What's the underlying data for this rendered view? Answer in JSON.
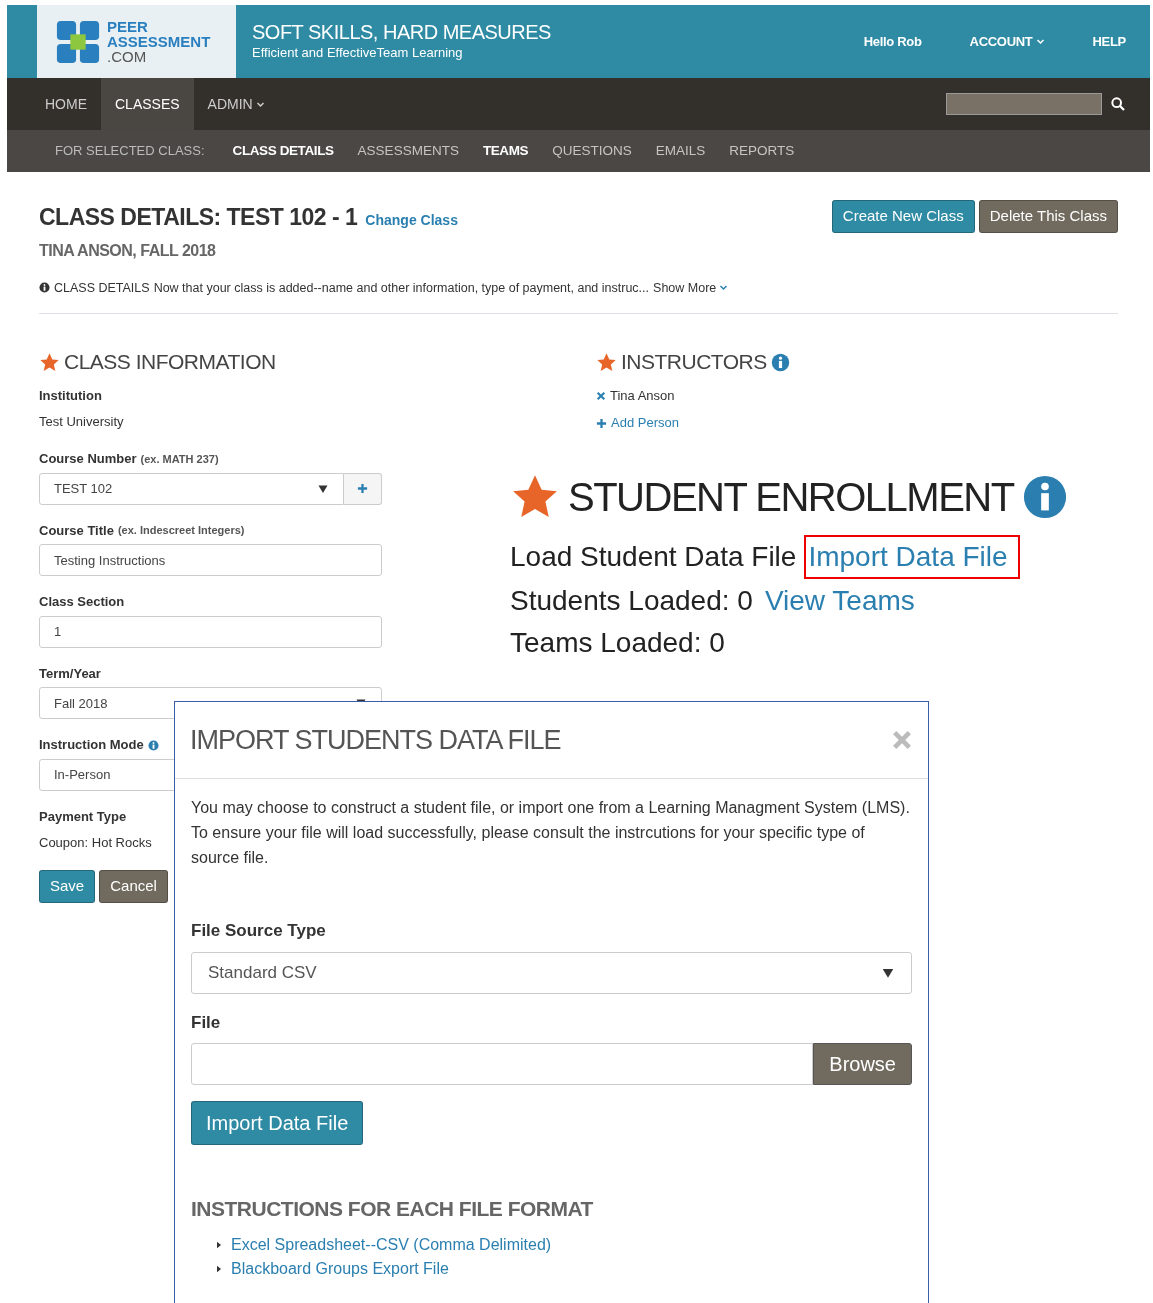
{
  "header": {
    "logo_lines": [
      "PEER",
      "ASSESSMENT",
      ".COM"
    ],
    "tagline": "SOFT SKILLS, HARD MEASURES",
    "subtagline": "Efficient and EffectiveTeam Learning",
    "links": [
      {
        "label": "Hello Rob",
        "dropdown": false
      },
      {
        "label": "ACCOUNT",
        "dropdown": true
      },
      {
        "label": "HELP",
        "dropdown": false
      }
    ]
  },
  "nav": {
    "items": [
      {
        "label": "HOME",
        "selected": false,
        "dropdown": false
      },
      {
        "label": "CLASSES",
        "selected": true,
        "dropdown": false
      },
      {
        "label": "ADMIN",
        "selected": false,
        "dropdown": true
      }
    ]
  },
  "subnav": {
    "label": "FOR SELECTED CLASS:",
    "items": [
      {
        "label": "CLASS DETAILS",
        "highlighted": true
      },
      {
        "label": "ASSESSMENTS",
        "highlighted": false
      },
      {
        "label": "TEAMS",
        "highlighted": true
      },
      {
        "label": "QUESTIONS",
        "highlighted": false
      },
      {
        "label": "EMAILS",
        "highlighted": false
      },
      {
        "label": "REPORTS",
        "highlighted": false
      }
    ]
  },
  "page": {
    "title": "CLASS DETAILS: TEST 102 - 1",
    "change_link": "Change Class",
    "subtitle": "TINA ANSON, FALL 2018",
    "buttons": [
      {
        "label": "Create New Class",
        "kind": "primary"
      },
      {
        "label": "Delete This Class",
        "kind": "secondary"
      }
    ],
    "info": {
      "label": "CLASS DETAILS",
      "text": "Now that your class is added--name and other information, type of payment, and instruc...",
      "more": "Show More"
    }
  },
  "class_info": {
    "heading": "CLASS INFORMATION",
    "fields": [
      {
        "kind": "static",
        "label": "Institution",
        "value": "Test University"
      },
      {
        "kind": "select_addon",
        "label": "Course Number",
        "hint": "(ex. MATH 237)",
        "value": "TEST 102"
      },
      {
        "kind": "text",
        "label": "Course Title",
        "hint": "(ex. Indescreet Integers)",
        "value": "Testing Instructions"
      },
      {
        "kind": "text",
        "label": "Class Section",
        "value": "1"
      },
      {
        "kind": "select",
        "label": "Term/Year",
        "value": "Fall 2018"
      },
      {
        "kind": "text",
        "label": "Instruction Mode",
        "info": true,
        "value": "In-Person"
      },
      {
        "kind": "static",
        "label": "Payment Type",
        "value": "Coupon: Hot Rocks"
      }
    ],
    "buttons": [
      {
        "label": "Save",
        "kind": "primary"
      },
      {
        "label": "Cancel",
        "kind": "secondary"
      }
    ]
  },
  "instructors": {
    "heading": "INSTRUCTORS",
    "people": [
      {
        "name": "Tina Anson"
      }
    ],
    "add": "Add Person"
  },
  "enrollment": {
    "heading": "STUDENT ENROLLMENT",
    "lines": [
      {
        "label": "Load Student Data File",
        "link": "Import Data File",
        "highlighted": true
      },
      {
        "label": "Students Loaded: 0",
        "link": "View Teams",
        "highlighted": false
      },
      {
        "label": "Teams Loaded: 0"
      }
    ]
  },
  "modal": {
    "title": "IMPORT STUDENTS DATA FILE",
    "intro": "You may choose to construct a student file, or import one from a Learning Managment System (LMS). To ensure your file will load successfully, please consult the instrcutions for your specific type of source file.",
    "source_label": "File Source Type",
    "source_value": "Standard CSV",
    "file_label": "File",
    "browse": "Browse",
    "submit": "Import Data File",
    "instructions_heading": "INSTRUCTIONS FOR EACH FILE FORMAT",
    "links": [
      "Excel Spreadsheet--CSV (Comma Delimited)",
      "Blackboard Groups Export File"
    ]
  }
}
